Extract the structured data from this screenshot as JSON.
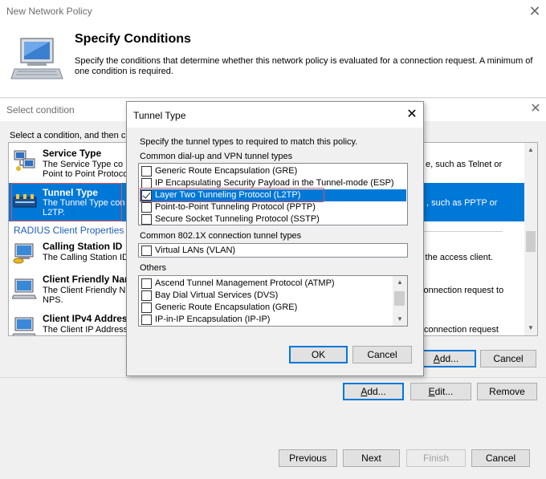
{
  "wizard": {
    "title": "New Network Policy",
    "heading": "Specify Conditions",
    "description": "Specify the conditions that determine whether this network policy is evaluated for a connection request. A minimum of one condition is required.",
    "buttons": {
      "add": "Add...",
      "edit": "Edit...",
      "remove": "Remove",
      "previous": "Previous",
      "next": "Next",
      "finish": "Finish",
      "cancel": "Cancel"
    }
  },
  "select_condition": {
    "title": "Select condition",
    "prompt": "Select a condition, and then cli",
    "items": [
      {
        "name": "Service Type",
        "desc": "The Service Type co",
        "desc2": "Point to Point Protoco",
        "right": "e, such as Telnet or"
      },
      {
        "name": "Tunnel Type",
        "desc": "The Tunnel Type con",
        "desc2": "L2TP.",
        "right": ", such as PPTP or"
      },
      {
        "name": "Calling Station ID",
        "desc": "The Calling Station ID",
        "right": "y the access client."
      },
      {
        "name": "Client Friendly Nam",
        "desc": "The Client Friendly N",
        "desc2": "NPS.",
        "right": "connection request to"
      },
      {
        "name": "Client IPv4 Address",
        "desc": "The Client IP Address",
        "right": "connection request"
      }
    ],
    "group_label": "RADIUS Client Properties",
    "buttons": {
      "add": "Add...",
      "cancel": "Cancel"
    }
  },
  "tunnel_type": {
    "title": "Tunnel Type",
    "instruction": "Specify the tunnel types to required to match this policy.",
    "group1_label": "Common dial-up and VPN tunnel types",
    "group1_items": [
      {
        "label": "Generic Route Encapsulation (GRE)",
        "checked": false,
        "selected": false
      },
      {
        "label": "IP Encapsulating Security Payload in the Tunnel-mode (ESP)",
        "checked": false,
        "selected": false
      },
      {
        "label": "Layer Two Tunneling Protocol (L2TP)",
        "checked": true,
        "selected": true
      },
      {
        "label": "Point-to-Point Tunneling Protocol (PPTP)",
        "checked": false,
        "selected": false
      },
      {
        "label": "Secure Socket Tunneling Protocol (SSTP)",
        "checked": false,
        "selected": false
      }
    ],
    "group2_label": "Common 802.1X connection tunnel types",
    "group2_items": [
      {
        "label": "Virtual LANs (VLAN)",
        "checked": false
      }
    ],
    "group3_label": "Others",
    "group3_items": [
      {
        "label": "Ascend Tunnel Management Protocol (ATMP)",
        "checked": false
      },
      {
        "label": "Bay Dial Virtual Services (DVS)",
        "checked": false
      },
      {
        "label": "Generic Route Encapsulation (GRE)",
        "checked": false
      },
      {
        "label": "IP-in-IP Encapsulation (IP-IP)",
        "checked": false
      }
    ],
    "ok": "OK",
    "cancel": "Cancel"
  },
  "colors": {
    "selection": "#0078d7",
    "highlight_box": "#e05050",
    "link": "#1e5fb4"
  }
}
